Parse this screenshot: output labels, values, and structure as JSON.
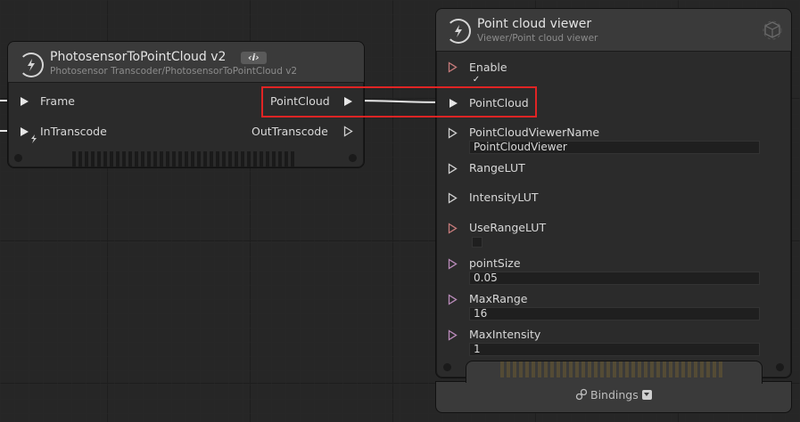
{
  "node_left": {
    "title": "PhotosensorToPointCloud v2",
    "badge": "‹i›",
    "subtitle": "Photosensor Transcoder/PhotosensorToPointCloud v2",
    "inputs": [
      "Frame",
      "InTranscode"
    ],
    "outputs": [
      "PointCloud",
      "OutTranscode"
    ]
  },
  "node_right": {
    "title": "Point cloud viewer",
    "subtitle": "Viewer/Point cloud viewer",
    "ports": {
      "enable": "Enable",
      "enable_check": "✓",
      "pointcloud": "PointCloud",
      "viewer_name": "PointCloudViewerName",
      "viewer_name_value": "PointCloudViewer",
      "range_lut": "RangeLUT",
      "intensity_lut": "IntensityLUT",
      "use_range_lut": "UseRangeLUT",
      "point_size": "pointSize",
      "point_size_value": "0.05",
      "max_range": "MaxRange",
      "max_range_value": "16",
      "max_intensity": "MaxIntensity",
      "max_intensity_value": "1"
    },
    "bindings_label": "Bindings"
  },
  "colors": {
    "background": "#262626",
    "node": "#2b2b2b",
    "header": "#3a3a3a",
    "highlight": "#e02424",
    "exec_port": "#c57a7a",
    "data_port": "#b98ab9"
  }
}
